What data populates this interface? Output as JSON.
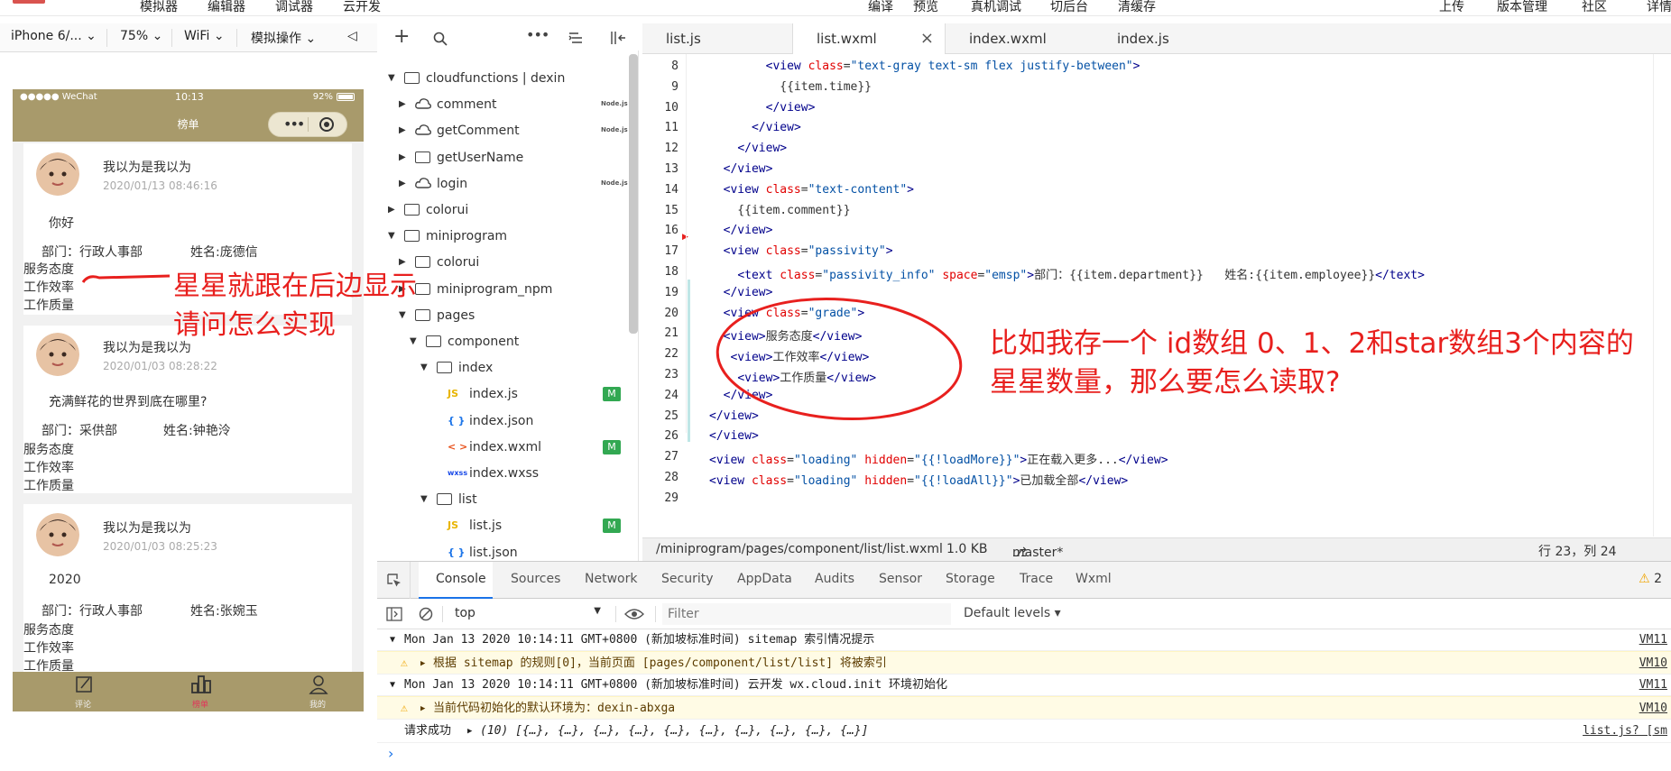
{
  "menu": {
    "items": [
      "模拟器",
      "编辑器",
      "调试器",
      "云开发"
    ],
    "right_items": [
      "编译",
      "预览",
      "真机调试",
      "切后台",
      "清缓存"
    ],
    "far_right": [
      "上传",
      "版本管理",
      "社区",
      "详情"
    ]
  },
  "sim_toolbar": {
    "device": "iPhone 6/...",
    "zoom": "75%",
    "network": "WiFi",
    "operation": "模拟操作"
  },
  "phone": {
    "status_left": "●●●●● WeChat",
    "status_time": "10:13",
    "status_battery": "92%",
    "nav_title": "榜单",
    "labels": [
      "服务态度",
      "工作效率",
      "工作质量"
    ],
    "cards": [
      {
        "name": "我以为是我以为",
        "time": "2020/01/13 08:46:16",
        "content": "你好",
        "department": "部门：行政人事部",
        "employee": "姓名:庞德信"
      },
      {
        "name": "我以为是我以为",
        "time": "2020/01/03 08:28:22",
        "content": "充满鲜花的世界到底在哪里?",
        "department": "部门：采供部",
        "employee": "姓名:钟艳泠"
      },
      {
        "name": "我以为是我以为",
        "time": "2020/01/03 08:25:23",
        "content": "2020",
        "department": "部门：行政人事部",
        "employee": "姓名:张婉玉"
      }
    ],
    "tabs": [
      {
        "label": "评论",
        "icon": "edit-icon"
      },
      {
        "label": "榜单",
        "icon": "chart-icon"
      },
      {
        "label": "我的",
        "icon": "user-icon"
      }
    ]
  },
  "filetree": {
    "items": [
      {
        "label": "cloudfunctions | dexin",
        "level": 0,
        "kind": "cloud-folder",
        "open": true
      },
      {
        "label": "comment",
        "level": 1,
        "kind": "cloud",
        "open": false,
        "node": true
      },
      {
        "label": "getComment",
        "level": 1,
        "kind": "cloud",
        "open": false,
        "node": true
      },
      {
        "label": "getUserName",
        "level": 1,
        "kind": "folder",
        "open": false
      },
      {
        "label": "login",
        "level": 1,
        "kind": "cloud",
        "open": false,
        "node": true
      },
      {
        "label": "colorui",
        "level": 0,
        "kind": "folder",
        "open": false
      },
      {
        "label": "miniprogram",
        "level": 0,
        "kind": "folder",
        "open": true
      },
      {
        "label": "colorui",
        "level": 1,
        "kind": "folder",
        "open": false
      },
      {
        "label": "miniprogram_npm",
        "level": 1,
        "kind": "folder",
        "open": false
      },
      {
        "label": "pages",
        "level": 1,
        "kind": "folder",
        "open": true
      },
      {
        "label": "component",
        "level": 2,
        "kind": "folder",
        "open": true
      },
      {
        "label": "index",
        "level": 3,
        "kind": "folder",
        "open": true
      },
      {
        "label": "index.js",
        "level": 4,
        "kind": "js",
        "badge": "M"
      },
      {
        "label": "index.json",
        "level": 4,
        "kind": "json"
      },
      {
        "label": "index.wxml",
        "level": 4,
        "kind": "wxml",
        "badge": "M"
      },
      {
        "label": "index.wxss",
        "level": 4,
        "kind": "wxss"
      },
      {
        "label": "list",
        "level": 3,
        "kind": "folder",
        "open": true
      },
      {
        "label": "list.js",
        "level": 4,
        "kind": "js",
        "badge": "M"
      },
      {
        "label": "list.json",
        "level": 4,
        "kind": "json"
      }
    ],
    "node_tag": "Node.js",
    "glyphs": {
      "js": "JS",
      "json": "{ }",
      "wxml": "< >",
      "wxss": "wxss"
    }
  },
  "editor_tabs": [
    "list.js",
    "list.wxml",
    "index.wxml",
    "index.js"
  ],
  "editor_tab_close": "×",
  "editor": {
    "line_numbers": [
      "8",
      "9",
      "10",
      "11",
      "12",
      "13",
      "14",
      "15",
      "16",
      "17",
      "18",
      "19",
      "20",
      "21",
      "22",
      "23",
      "24",
      "25",
      "26",
      "27",
      "28",
      "29"
    ],
    "lines": [
      "        <view class=\"text-gray text-sm flex justify-between\">",
      "          {{item.time}}",
      "        </view>",
      "      </view>",
      "    </view>",
      "  </view>",
      "  <view class=\"text-content\">",
      "    {{item.comment}}",
      "  </view>",
      "  <view class=\"passivity\">",
      "    <text class=\"passivity_info\" space=\"emsp\">部门：{{item.department}}   姓名:{{item.employee}}</text>",
      "  </view>",
      "  <view class=\"grade\">",
      "  <view>服务态度</view>",
      "   <view>工作效率</view>",
      "    <view>工作质量</view>",
      "  </view>",
      "</view>",
      "</view>",
      "<view class=\"loading\" hidden=\"{{!loadMore}}\">正在载入更多...</view>",
      "<view class=\"loading\" hidden=\"{{!loadAll}}\">已加载全部</view>",
      ""
    ]
  },
  "editor_status": {
    "path": "/miniprogram/pages/component/list/list.wxml",
    "size": "1.0 KB",
    "branch": "master*",
    "position": "行 23，列 24"
  },
  "devtools": {
    "tabs": [
      "Console",
      "Sources",
      "Network",
      "Security",
      "AppData",
      "Audits",
      "Sensor",
      "Storage",
      "Trace",
      "Wxml"
    ],
    "warn_count": "2",
    "context": "top",
    "filter_placeholder": "Filter",
    "levels": "Default levels",
    "logs": [
      {
        "type": "group",
        "text": "Mon Jan 13 2020 10:14:11 GMT+0800 (新加坡标准时间) sitemap 索引情况提示",
        "src": "VM11"
      },
      {
        "type": "warn",
        "text": "根据 sitemap 的规则[0]，当前页面 [pages/component/list/list] 将被索引",
        "src": "VM10"
      },
      {
        "type": "group",
        "text": "Mon Jan 13 2020 10:14:11 GMT+0800 (新加坡标准时间) 云开发 wx.cloud.init 环境初始化",
        "src": "VM11"
      },
      {
        "type": "warn",
        "text": "当前代码初始化的默认环境为：dexin-abxga",
        "src": "VM10"
      },
      {
        "type": "log",
        "text": "请求成功",
        "extra": "(10) [{…}, {…}, {…}, {…}, {…}, {…}, {…}, {…}, {…}, {…}]",
        "src": "list.js? [sm"
      }
    ],
    "prompt": "›"
  },
  "annotations": {
    "left_line1": "星星就跟在后边显示",
    "left_line2": "请问怎么实现",
    "right_line1": "比如我存一个 id数组 0、1、2和star数组3个内容的",
    "right_line2": "星星数量，那么要怎么读取?"
  },
  "colors": {
    "brand": "#a89a6b",
    "annotation": "#e8201e",
    "badge": "#32a852"
  }
}
